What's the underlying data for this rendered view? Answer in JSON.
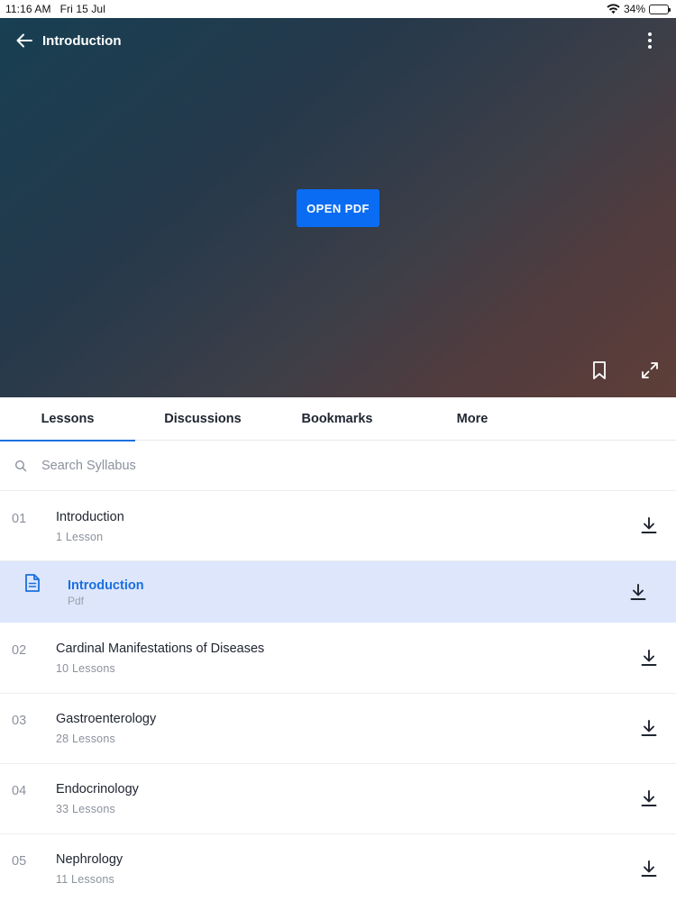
{
  "status_bar": {
    "time": "11:16 AM",
    "date": "Fri 15 Jul",
    "battery": "34%",
    "battery_level": 0.34,
    "icons": [
      "wifi-icon",
      "battery-icon"
    ]
  },
  "player": {
    "title": "Introduction",
    "open_button": "OPEN PDF",
    "icons": [
      "back-arrow-icon",
      "more-vertical-icon",
      "bookmark-icon",
      "expand-icon"
    ]
  },
  "tabs": [
    {
      "label": "Lessons",
      "active": true
    },
    {
      "label": "Discussions",
      "active": false
    },
    {
      "label": "Bookmarks",
      "active": false
    },
    {
      "label": "More",
      "active": false
    }
  ],
  "search": {
    "placeholder": "Search Syllabus"
  },
  "chapters": [
    {
      "number": "01",
      "title": "Introduction",
      "subtitle": "1 Lesson"
    },
    {
      "number": "02",
      "title": "Cardinal Manifestations of Diseases",
      "subtitle": "10 Lessons"
    },
    {
      "number": "03",
      "title": "Gastroenterology",
      "subtitle": "28 Lessons"
    },
    {
      "number": "04",
      "title": "Endocrinology",
      "subtitle": "33 Lessons"
    },
    {
      "number": "05",
      "title": "Nephrology",
      "subtitle": "11 Lessons"
    }
  ],
  "active_lesson": {
    "title": "Introduction",
    "type": "Pdf"
  },
  "colors": {
    "accent": "#1a6fe0",
    "button": "#0a6cf2",
    "highlight": "#dde6fb"
  }
}
